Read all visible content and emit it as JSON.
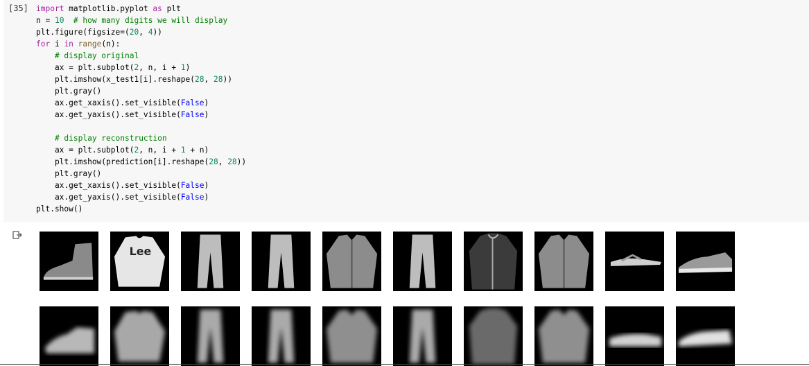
{
  "cell": {
    "execution_count": "[35]",
    "code_lines": [
      "import matplotlib.pyplot as plt",
      "n = 10  # how many digits we will display",
      "plt.figure(figsize=(20, 4))",
      "for i in range(n):",
      "    # display original",
      "    ax = plt.subplot(2, n, i + 1)",
      "    plt.imshow(x_test1[i].reshape(28, 28))",
      "    plt.gray()",
      "    ax.get_xaxis().set_visible(False)",
      "    ax.get_yaxis().set_visible(False)",
      "",
      "    # display reconstruction",
      "    ax = plt.subplot(2, n, i + 1 + n)",
      "    plt.imshow(prediction[i].reshape(28, 28))",
      "    plt.gray()",
      "    ax.get_xaxis().set_visible(False)",
      "    ax.get_yaxis().set_visible(False)",
      "plt.show()"
    ]
  },
  "output": {
    "icon": "output-arrow-icon",
    "originals": [
      "ankle-boot",
      "pullover",
      "trouser",
      "trouser",
      "shirt",
      "trouser",
      "coat",
      "shirt",
      "sandal",
      "sneaker"
    ],
    "reconstructions": [
      "ankle-boot",
      "pullover",
      "trouser",
      "trouser",
      "shirt",
      "trouser",
      "coat",
      "shirt",
      "sandal",
      "sneaker"
    ]
  },
  "colors": {
    "cell_bg": "#f7f7f7",
    "keyword": "#a626a4",
    "number": "#098658",
    "comment": "#008000",
    "boolean": "#0000ff"
  }
}
